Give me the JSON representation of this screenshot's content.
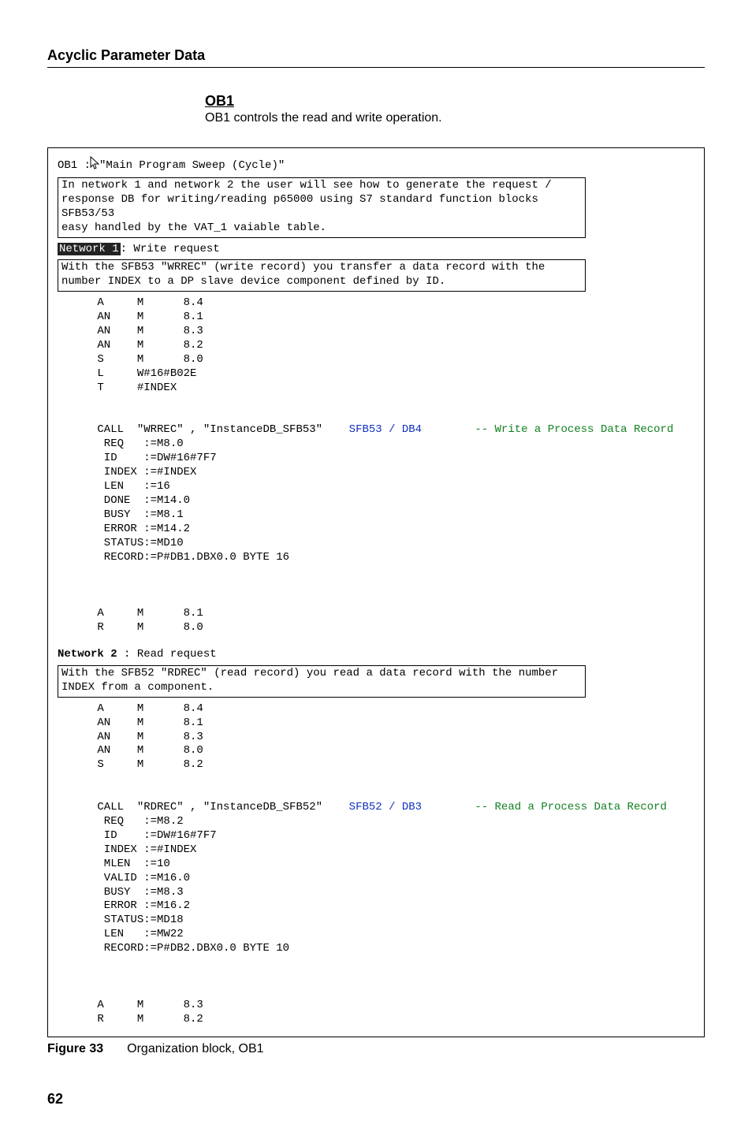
{
  "header": "Acyclic Parameter Data",
  "section": {
    "heading": "OB1",
    "desc": "OB1 controls the read and write operation."
  },
  "code": {
    "ob_title": "OB1 : ",
    "ob_title2": "\"Main Program Sweep (Cycle)\"",
    "intro_box": "In network 1 and network 2 the user will see how to generate the request /\nresponse DB for writing/reading p65000 using S7 standard function blocks\nSFB53/53\neasy handled by the VAT_1 vaiable table.",
    "nw1_label": "Network 1",
    "nw1_title": ": Write request",
    "nw1_box": "With the SFB53 \"WRREC\" (write record) you transfer a data record with the\nnumber INDEX to a DP slave device component defined by ID.",
    "nw1_code_pre": "      A     M      8.4\n      AN    M      8.1\n      AN    M      8.3\n      AN    M      8.2\n      S     M      8.0\n      L     W#16#B02E\n      T     #INDEX\n\n\n",
    "nw1_call_a": "      CALL  \"WRREC\" , \"InstanceDB_SFB53\"    ",
    "nw1_call_b": "SFB53 / DB4",
    "nw1_call_c": "        ",
    "nw1_call_d": "-- Write a Process Data Record",
    "nw1_code_post": "\n       REQ   :=M8.0\n       ID    :=DW#16#7F7\n       INDEX :=#INDEX\n       LEN   :=16\n       DONE  :=M14.0\n       BUSY  :=M8.1\n       ERROR :=M14.2\n       STATUS:=MD10\n       RECORD:=P#DB1.DBX0.0 BYTE 16\n\n\n\n      A     M      8.1\n      R     M      8.0",
    "nw2_label": "Network 2",
    "nw2_title": " : Read request",
    "nw2_box": "With the SFB52 \"RDREC\" (read record) you read a data record with the number\nINDEX from a component.",
    "nw2_code_pre": "      A     M      8.4\n      AN    M      8.1\n      AN    M      8.3\n      AN    M      8.0\n      S     M      8.2\n\n\n",
    "nw2_call_a": "      CALL  \"RDREC\" , \"InstanceDB_SFB52\"    ",
    "nw2_call_b": "SFB52 / DB3",
    "nw2_call_c": "        ",
    "nw2_call_d": "-- Read a Process Data Record",
    "nw2_code_post": "\n       REQ   :=M8.2\n       ID    :=DW#16#7F7\n       INDEX :=#INDEX\n       MLEN  :=10\n       VALID :=M16.0\n       BUSY  :=M8.3\n       ERROR :=M16.2\n       STATUS:=MD18\n       LEN   :=MW22\n       RECORD:=P#DB2.DBX0.0 BYTE 10\n\n\n\n      A     M      8.3\n      R     M      8.2"
  },
  "figure": {
    "label": "Figure 33",
    "caption": "Organization block, OB1"
  },
  "page_number": "62"
}
